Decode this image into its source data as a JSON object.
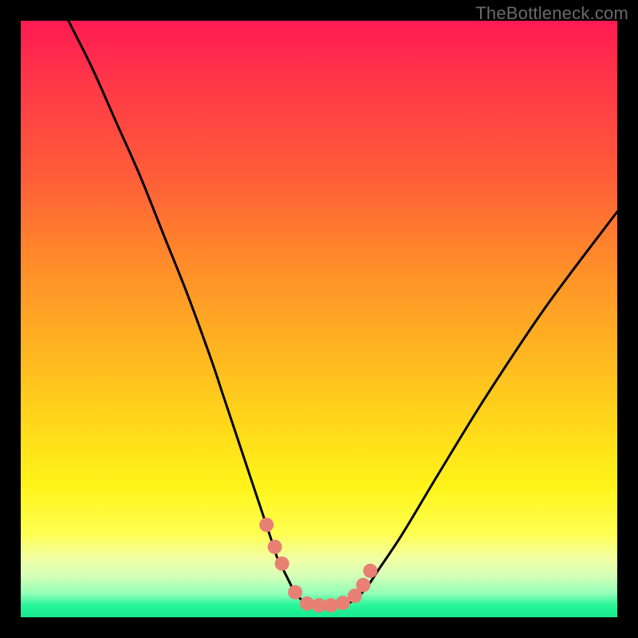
{
  "watermark": {
    "text": "TheBottleneck.com"
  },
  "chart_data": {
    "type": "line",
    "title": "",
    "xlabel": "",
    "ylabel": "",
    "xlim": [
      0,
      100
    ],
    "ylim": [
      0,
      100
    ],
    "series": [
      {
        "name": "bottleneck-curve",
        "x": [
          8,
          12,
          16,
          20,
          24,
          28,
          32,
          34,
          36,
          38,
          40,
          41,
          42,
          43,
          44,
          45,
          46,
          47,
          48,
          49,
          50,
          52,
          54,
          56,
          58,
          60,
          64,
          70,
          78,
          88,
          100
        ],
        "y": [
          100,
          92,
          83,
          74,
          64,
          54,
          43,
          37,
          31,
          25,
          19,
          16,
          13,
          10,
          8,
          6,
          4,
          3,
          2,
          2,
          2,
          2,
          2,
          3,
          5,
          8,
          14,
          24,
          37,
          52,
          68
        ]
      }
    ],
    "markers": {
      "name": "highlight-dots",
      "color": "#e88074",
      "points_x": [
        41.2,
        42.6,
        43.8,
        46.0,
        48.0,
        50.0,
        52.0,
        54.0,
        56.0,
        57.4,
        58.6
      ],
      "points_y": [
        15.5,
        11.8,
        9.0,
        4.2,
        2.3,
        2.0,
        2.0,
        2.4,
        3.6,
        5.4,
        7.8
      ]
    },
    "gradient_stops": [
      {
        "pos": 0.0,
        "color": "#ff1a52"
      },
      {
        "pos": 0.4,
        "color": "#ff8a2a"
      },
      {
        "pos": 0.78,
        "color": "#fff419"
      },
      {
        "pos": 0.96,
        "color": "#92ffb8"
      },
      {
        "pos": 1.0,
        "color": "#17e98e"
      }
    ]
  }
}
